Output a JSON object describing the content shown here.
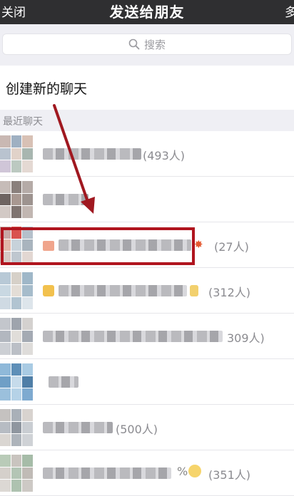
{
  "header": {
    "close": "关闭",
    "title": "发送给朋友",
    "multi": "多"
  },
  "search": {
    "placeholder": "搜索"
  },
  "new_chat": "创建新的聊天",
  "section_title": "最近聊天",
  "chats": [
    {
      "count": "(493人)"
    },
    {
      "count": ""
    },
    {
      "count": "(27人)"
    },
    {
      "count": "(312人)"
    },
    {
      "count": "309人)"
    },
    {
      "count": ""
    },
    {
      "count": "(500人)"
    },
    {
      "count": "(351人)"
    }
  ],
  "colors": {
    "header_bg": "#2f2f31",
    "highlight": "#b0141e",
    "arrow": "#a01820"
  }
}
